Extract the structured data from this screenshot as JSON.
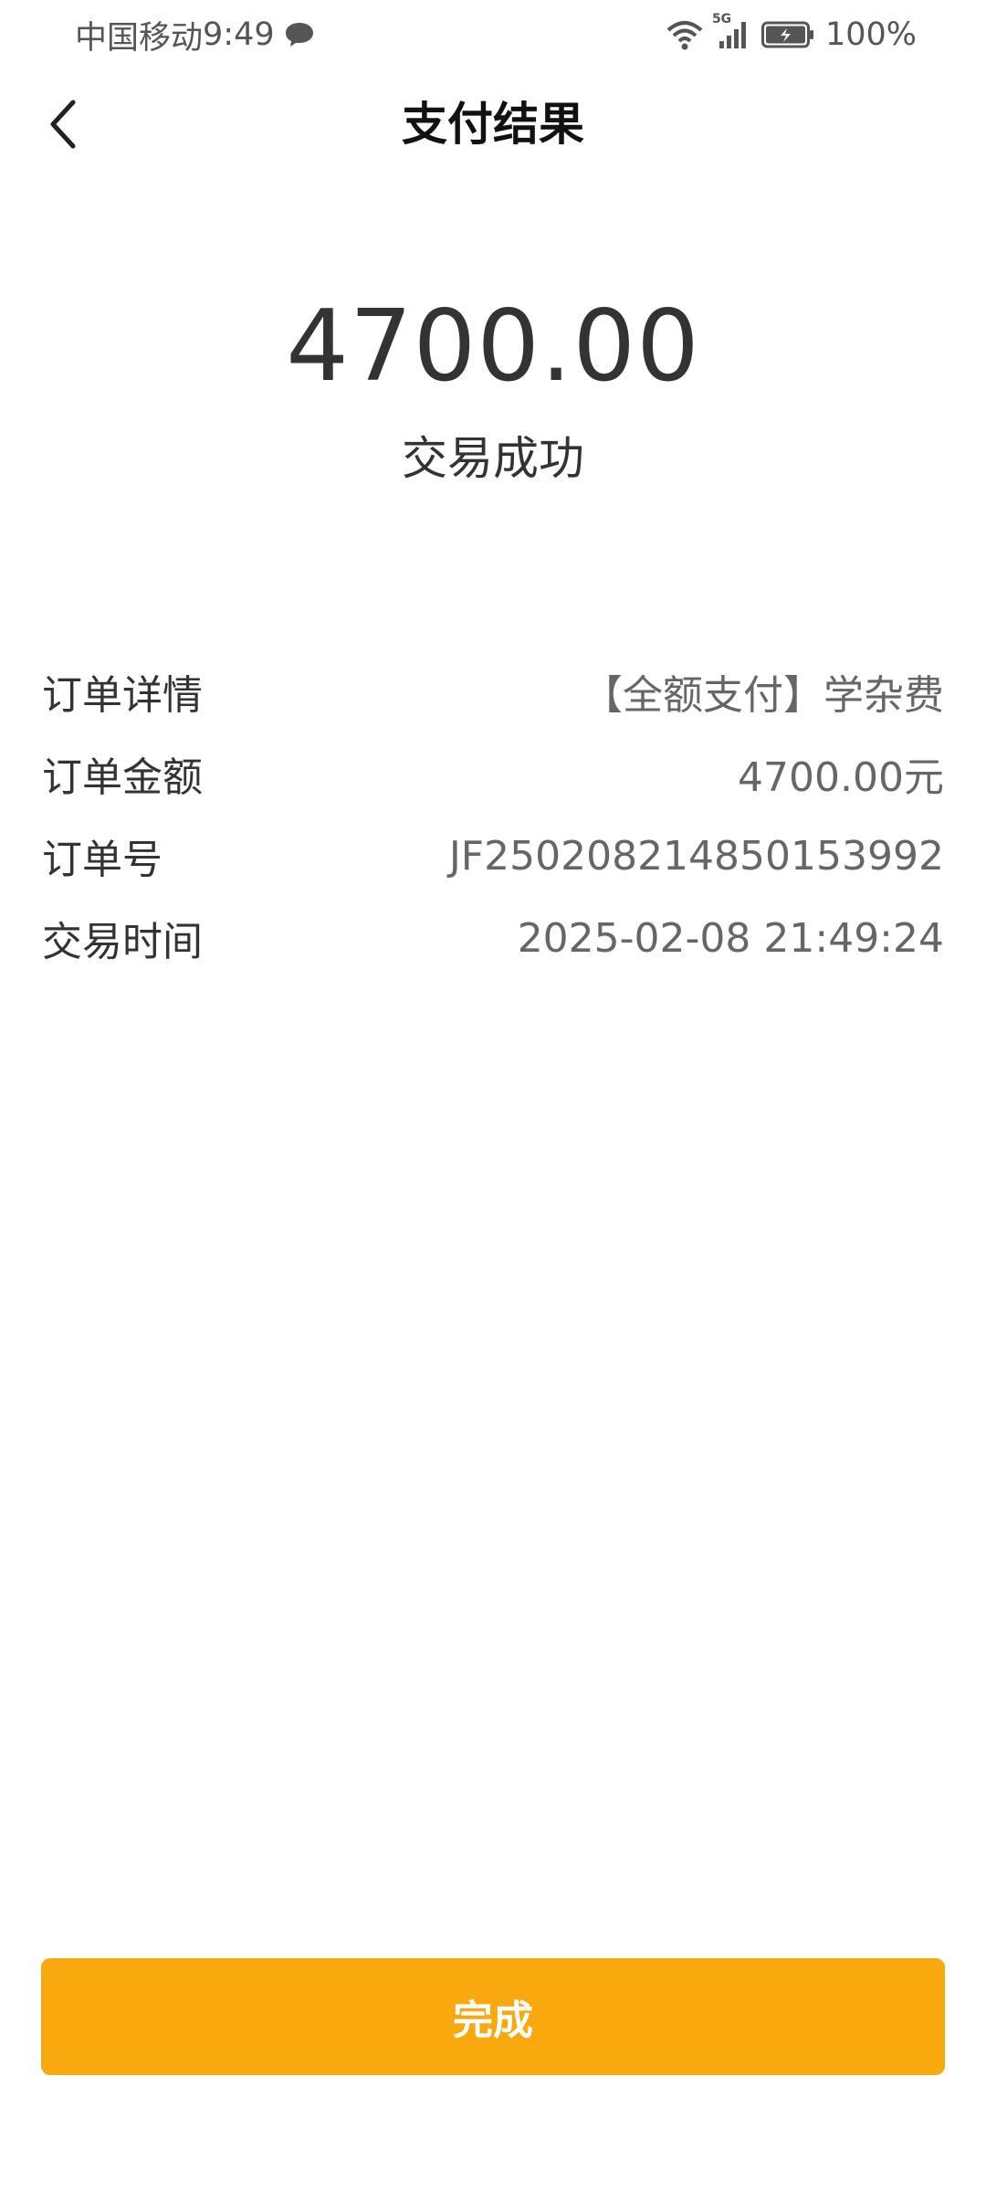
{
  "status_bar": {
    "carrier": "中国移动",
    "time": "9:49",
    "network": "5G",
    "battery": "100%"
  },
  "header": {
    "title": "支付结果",
    "back_icon": "chevron-left-icon"
  },
  "result": {
    "amount": "4700.00",
    "status": "交易成功"
  },
  "details": [
    {
      "label": "订单详情",
      "value": "【全额支付】学杂费"
    },
    {
      "label": "订单金额",
      "value": "4700.00元"
    },
    {
      "label": "订单号",
      "value": "JF2502082148501539​92"
    },
    {
      "label": "交易时间",
      "value": "2025-02-08 21:49:24"
    }
  ],
  "footer": {
    "done_label": "完成"
  },
  "colors": {
    "accent": "#f9a90e",
    "text_primary": "#333333",
    "text_secondary": "#666666",
    "background": "#ffffff"
  }
}
